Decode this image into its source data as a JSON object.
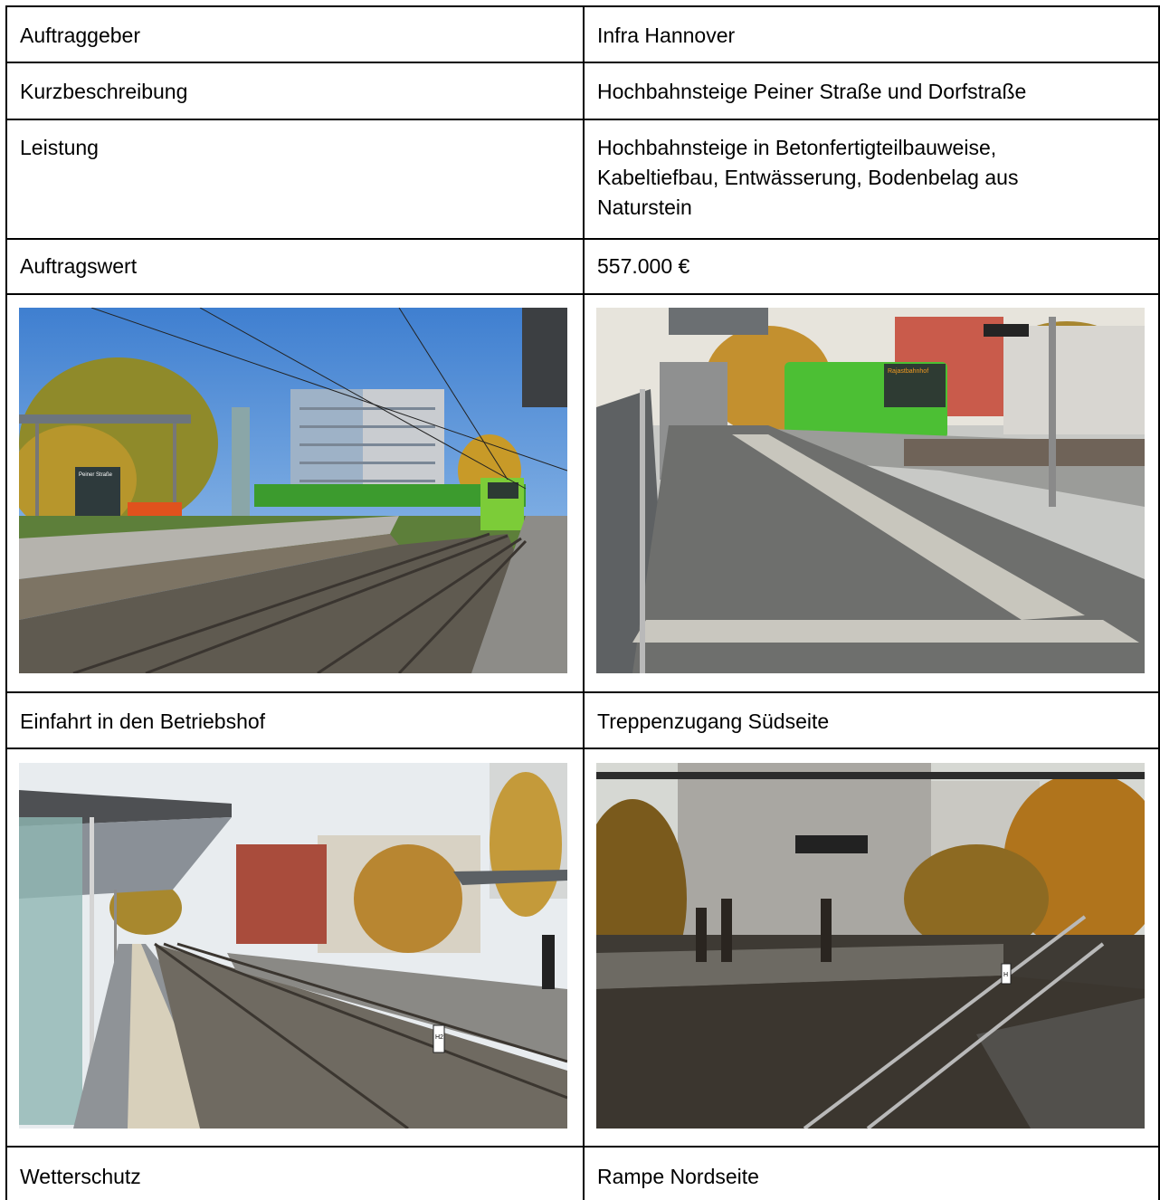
{
  "rows": [
    {
      "label": "Auftraggeber",
      "value": "Infra Hannover"
    },
    {
      "label": "Kurzbeschreibung",
      "value": "Hochbahnsteige Peiner Straße und Dorfstraße"
    },
    {
      "label": "Leistung",
      "value": "Hochbahnsteige in Betonfertigteilbauweise, Kabeltiefbau, Entwässerung, Bodenbelag aus Naturstein"
    },
    {
      "label": "Auftragswert",
      "value": "557.000 €"
    }
  ],
  "photos": [
    {
      "caption": "Einfahrt in den Betriebshof",
      "sign_text": "Peiner Straße",
      "tram_display": ""
    },
    {
      "caption": "Treppenzugang Südseite",
      "tram_display": "Rajastbahnhof"
    },
    {
      "caption": "Wetterschutz",
      "marker_label": "H2"
    },
    {
      "caption": "Rampe Nordseite",
      "marker_label": "H"
    }
  ],
  "colors": {
    "border": "#000000",
    "tram_green": "#6bc02c",
    "sky": "#6fa6e0"
  }
}
